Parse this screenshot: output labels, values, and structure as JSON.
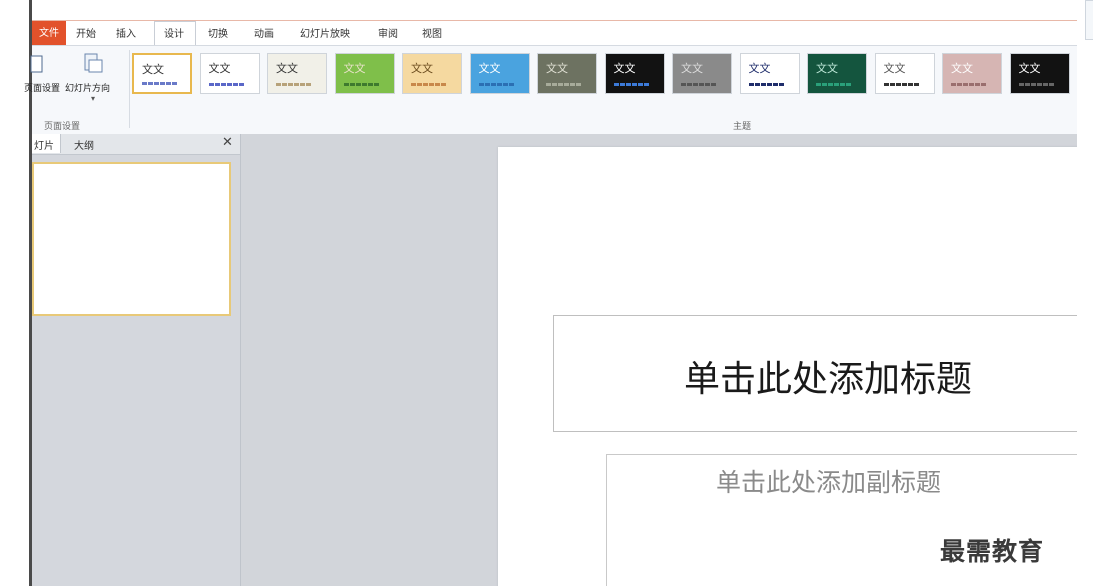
{
  "ribbon": {
    "tabs": {
      "file": "文件",
      "home": "开始",
      "insert": "插入",
      "design": "设计",
      "transitions": "切换",
      "animations": "动画",
      "slideshow": "幻灯片放映",
      "review": "审阅",
      "view": "视图"
    },
    "page_setup": {
      "setup_label": "页面设置",
      "orientation_label": "幻灯片方向",
      "group_label": "页面设置"
    },
    "themes": {
      "group_label": "主题",
      "sample_text": "文文",
      "items": [
        {
          "bg": "#ffffff",
          "fg": "#333333",
          "swatch": "#6a7ac8",
          "selected": true
        },
        {
          "bg": "#ffffff",
          "fg": "#333333",
          "swatch": "#5a67c8",
          "selected": false
        },
        {
          "bg": "#f1f0e8",
          "fg": "#333333",
          "swatch": "#b7a27a",
          "selected": false
        },
        {
          "bg": "#7fbf4a",
          "fg": "#e8e2c8",
          "swatch": "#3e7a2e",
          "selected": false
        },
        {
          "bg": "#f5d9a0",
          "fg": "#6b4c1e",
          "swatch": "#c8884a",
          "selected": false
        },
        {
          "bg": "#4aa3df",
          "fg": "#ffffff",
          "swatch": "#2b6fb3",
          "selected": false
        },
        {
          "bg": "#6d7261",
          "fg": "#e0e0d4",
          "swatch": "#a7ab9a",
          "selected": false
        },
        {
          "bg": "#121212",
          "fg": "#ffffff",
          "swatch": "#3c7ad8",
          "selected": false
        },
        {
          "bg": "#8a8a8a",
          "fg": "#dddddd",
          "swatch": "#555555",
          "selected": false
        },
        {
          "bg": "#ffffff",
          "fg": "#1f2d6b",
          "swatch": "#1f2d6b",
          "selected": false
        },
        {
          "bg": "#14553e",
          "fg": "#bfe9d9",
          "swatch": "#2aa07a",
          "selected": false
        },
        {
          "bg": "#ffffff",
          "fg": "#555555",
          "swatch": "#333333",
          "selected": false
        },
        {
          "bg": "#d6b5b3",
          "fg": "#ffffff",
          "swatch": "#9a6e6e",
          "selected": false
        },
        {
          "bg": "#121212",
          "fg": "#ffffff",
          "swatch": "#666666",
          "selected": false
        }
      ]
    }
  },
  "panel": {
    "tab_slides": "灯片",
    "tab_outline": "大纲",
    "close_symbol": "✕"
  },
  "slide": {
    "title_placeholder": "单击此处添加标题",
    "subtitle_placeholder": "单击此处添加副标题"
  },
  "watermark": "最需教育"
}
